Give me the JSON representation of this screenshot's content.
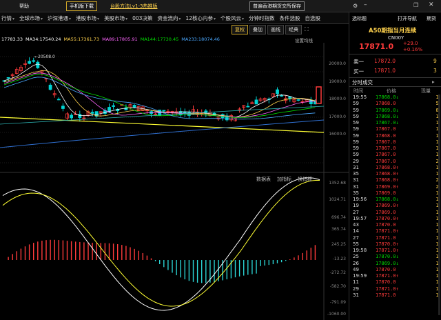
{
  "topbar": {
    "app_label": "帮助",
    "tabs": [
      "手机版下载",
      "台股方法Lv1-3热推版",
      "普遍香港期货交所保存"
    ]
  },
  "nav": {
    "items": [
      "行情",
      "全球市场",
      "沪深港通",
      "港股市场",
      "美股市场",
      "003决策",
      "资金流向",
      "12核心内参",
      "个股风云",
      "分钟时指数",
      "条件选股",
      "自选股"
    ]
  },
  "toolbar": {
    "buttons": [
      "复权",
      "叠加",
      "画线",
      "经典"
    ]
  },
  "ma_line": [
    {
      "text": "17783.33",
      "color": "#ffffff"
    },
    {
      "text": "MA34:17540.24",
      "color": "#ffffff"
    },
    {
      "text": "MA55:17361.73",
      "color": "#ffd24d"
    },
    {
      "text": "MA89:17805.91",
      "color": "#ff66ff"
    },
    {
      "text": "MA144:17730.45",
      "color": "#00e000"
    },
    {
      "text": "MA233:18074.46",
      "color": "#4aa8ff"
    },
    {
      "text": "设置均线",
      "color": "#bbbbbb"
    }
  ],
  "chart_labels": {
    "peak": "20508.0",
    "indicator_tabs": [
      "数据表",
      "加指标",
      "换指标"
    ]
  },
  "price_axis": [
    "20000.0",
    "19000.0",
    "18000.0",
    "17000.0",
    "16000.0"
  ],
  "macd_axis": [
    "1352.68",
    "1024.71",
    "696.74",
    "365.74",
    "245.25",
    "-13.23",
    "-272.72",
    "-582.70",
    "-791.09",
    "-1060.00"
  ],
  "right_panel": {
    "tabs": [
      "选标题",
      "打开导航",
      "期货"
    ],
    "title": "A50期指当月连续",
    "code": "CN00Y",
    "price": "17871.0",
    "change": "+29.0",
    "change_pct": "+0.16%",
    "ask_label": "卖一",
    "ask_price": "17872.0",
    "ask_vol": "9",
    "bid_label": "买一",
    "bid_price": "17871.0",
    "bid_vol": "3",
    "section": "分时成交",
    "headers": [
      "时间",
      "价格",
      "现量"
    ]
  },
  "colors": {
    "up": "#ff3b3b",
    "down": "#00d400",
    "bg": "#000000"
  },
  "trades": [
    {
      "t": "19:55",
      "p": "17868.0",
      "d": "down",
      "v": "1"
    },
    {
      "t": "59",
      "p": "17868.0",
      "d": "",
      "v": "5"
    },
    {
      "t": "59",
      "p": "17869.0",
      "d": "down",
      "v": "8"
    },
    {
      "t": "59",
      "p": "17868.0",
      "d": "down",
      "v": "1"
    },
    {
      "t": "59",
      "p": "17867.0",
      "d": "down",
      "v": "1"
    },
    {
      "t": "59",
      "p": "17867.0",
      "d": "",
      "v": "1"
    },
    {
      "t": "59",
      "p": "17868.0",
      "d": "",
      "v": "1"
    },
    {
      "t": "59",
      "p": "17867.0",
      "d": "",
      "v": "1"
    },
    {
      "t": "59",
      "p": "17867.0",
      "d": "",
      "v": "1"
    },
    {
      "t": "59",
      "p": "17867.0",
      "d": "",
      "v": "1"
    },
    {
      "t": "29",
      "p": "17867.0",
      "d": "",
      "v": "2"
    },
    {
      "t": "31",
      "p": "17868.0",
      "d": "up",
      "v": "1"
    },
    {
      "t": "35",
      "p": "17868.0",
      "d": "up",
      "v": "1"
    },
    {
      "t": "31",
      "p": "17868.0",
      "d": "up",
      "v": "2"
    },
    {
      "t": "31",
      "p": "17869.0",
      "d": "up",
      "v": "2"
    },
    {
      "t": "35",
      "p": "17869.0",
      "d": "",
      "v": "1"
    },
    {
      "t": "19:56",
      "p": "17868.0",
      "d": "down",
      "v": "1"
    },
    {
      "t": "19",
      "p": "17869.0",
      "d": "up",
      "v": "1"
    },
    {
      "t": "27",
      "p": "17869.0",
      "d": "",
      "v": "1"
    },
    {
      "t": "19:57",
      "p": "17870.0",
      "d": "up",
      "v": "1"
    },
    {
      "t": "43",
      "p": "17870.0",
      "d": "",
      "v": "1"
    },
    {
      "t": "14",
      "p": "17871.0",
      "d": "up",
      "v": "1"
    },
    {
      "t": "27",
      "p": "17871.0",
      "d": "",
      "v": "1"
    },
    {
      "t": "55",
      "p": "17870.0",
      "d": "up",
      "v": "1"
    },
    {
      "t": "19:58",
      "p": "17871.0",
      "d": "up",
      "v": "1"
    },
    {
      "t": "25",
      "p": "17870.0",
      "d": "down",
      "v": "1"
    },
    {
      "t": "26",
      "p": "17869.0",
      "d": "down",
      "v": "1"
    },
    {
      "t": "49",
      "p": "17870.0",
      "d": "",
      "v": "1"
    },
    {
      "t": "19:59",
      "p": "17871.0",
      "d": "up",
      "v": "1"
    },
    {
      "t": "11",
      "p": "17870.0",
      "d": "",
      "v": "1"
    },
    {
      "t": "29",
      "p": "17871.0",
      "d": "up",
      "v": "1"
    },
    {
      "t": "31",
      "p": "17871.0",
      "d": "",
      "v": "1"
    }
  ]
}
